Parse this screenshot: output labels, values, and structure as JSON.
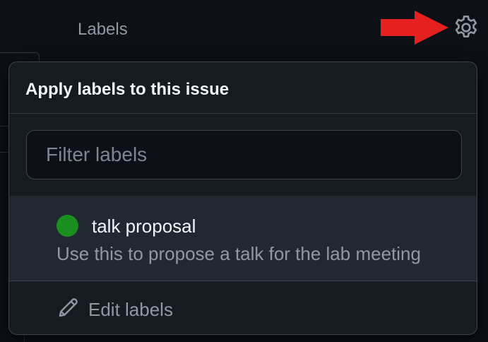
{
  "sidebar": {
    "heading": "Labels",
    "settings_icon": "gear-icon"
  },
  "annotation": {
    "arrow_color": "#e5201f",
    "arrow_icon": "arrow-right-icon"
  },
  "popover": {
    "title": "Apply labels to this issue",
    "filter": {
      "placeholder": "Filter labels",
      "value": ""
    },
    "labels": [
      {
        "name": "talk proposal",
        "description": "Use this to propose a talk for the lab meeting",
        "color": "#1a8f1f"
      }
    ],
    "edit": {
      "label": "Edit labels",
      "icon": "pencil-icon"
    }
  },
  "theme": {
    "background": "#0d1117",
    "surface": "#161b22",
    "hover": "#212830",
    "border": "#3d444d",
    "text": "#f0f6fc",
    "muted": "#9198a1"
  }
}
